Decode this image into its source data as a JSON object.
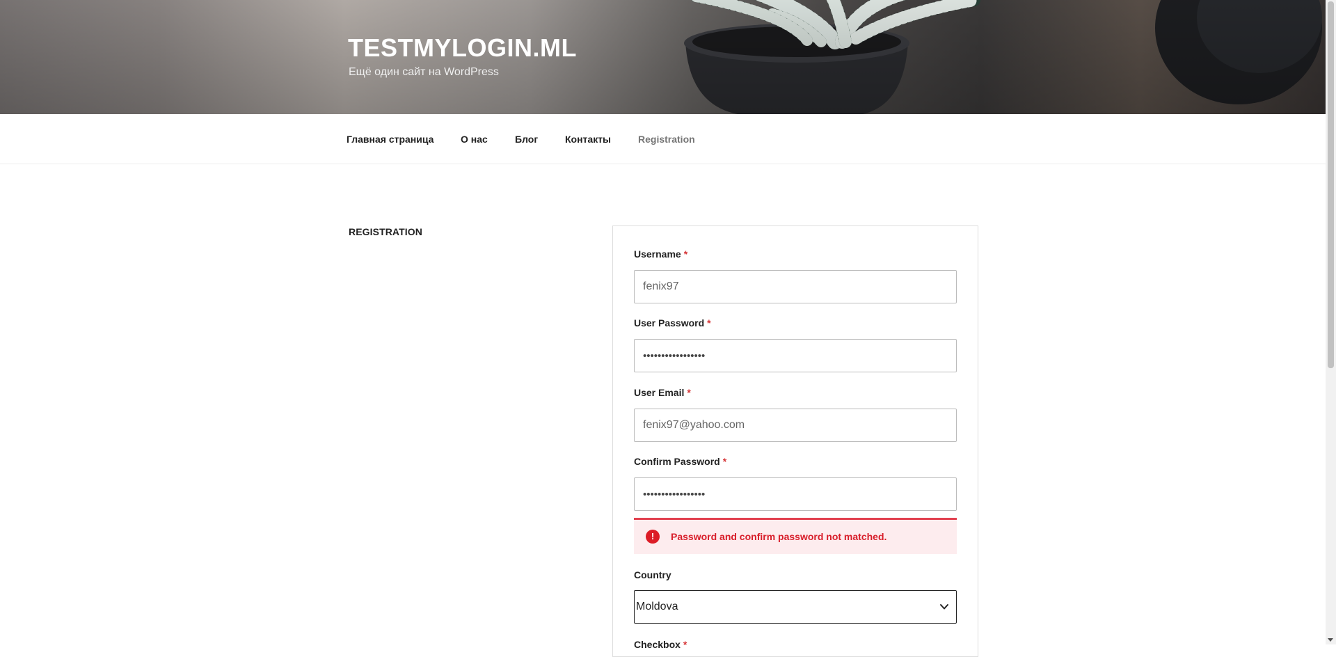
{
  "site": {
    "title": "TESTMYLOGIN.ML",
    "description": "Ещё один сайт на WordPress"
  },
  "nav": {
    "items": [
      {
        "label": "Главная страница"
      },
      {
        "label": "О нас"
      },
      {
        "label": "Блог"
      },
      {
        "label": "Контакты"
      },
      {
        "label": "Registration",
        "current": true
      }
    ]
  },
  "page": {
    "title": "REGISTRATION"
  },
  "form": {
    "username": {
      "label": "Username",
      "required_mark": "*",
      "value": "fenix97"
    },
    "password": {
      "label": "User Password",
      "required_mark": "*",
      "value": "•••••••••••••••••"
    },
    "email": {
      "label": "User Email",
      "required_mark": "*",
      "value": "fenix97@yahoo.com"
    },
    "confirm_password": {
      "label": "Confirm Password",
      "required_mark": "*",
      "value": "•••••••••••••••••"
    },
    "error": {
      "icon": "error-icon",
      "icon_glyph": "!",
      "message": "Password and confirm password not matched."
    },
    "country": {
      "label": "Country",
      "selected": "Moldova"
    },
    "checkbox": {
      "label": "Checkbox",
      "required_mark": "*"
    }
  },
  "colors": {
    "error_red": "#d81e2a",
    "error_bg": "#fdecee",
    "required_red": "#d63638"
  }
}
